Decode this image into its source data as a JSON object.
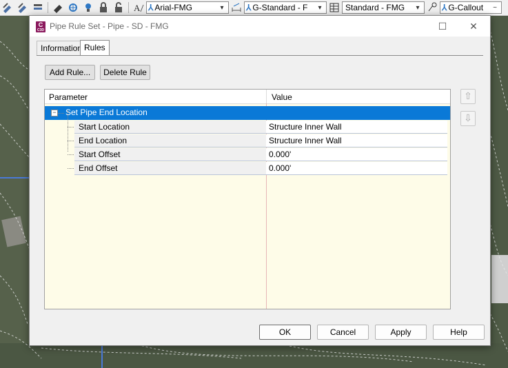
{
  "toolbar": {
    "text_style": "Arial-FMG",
    "dim_style": "G-Standard - F",
    "table_style": "Standard - FMG",
    "mleader_style": "G-Callout"
  },
  "dialog": {
    "app_icon_letter": "C",
    "app_icon_sub": "C3D",
    "title": "Pipe Rule Set - Pipe - SD  -  FMG",
    "maximize_glyph": "☐",
    "close_glyph": "✕",
    "tabs": [
      {
        "label": "Information",
        "active": false
      },
      {
        "label": "Rules",
        "active": true
      }
    ],
    "add_rule_label": "Add Rule...",
    "delete_rule_label": "Delete Rule",
    "grid": {
      "col_parameter": "Parameter",
      "col_value": "Value",
      "group": {
        "label": "Set Pipe End Location",
        "expander": "−"
      },
      "rows": [
        {
          "param": "Start Location",
          "value": "Structure Inner Wall"
        },
        {
          "param": "End Location",
          "value": "Structure Inner Wall"
        },
        {
          "param": "Start Offset",
          "value": "0.000'"
        },
        {
          "param": "End Offset",
          "value": "0.000'"
        }
      ]
    },
    "move_up_glyph": "⇧",
    "move_down_glyph": "⇩",
    "buttons": {
      "ok": "OK",
      "cancel": "Cancel",
      "apply": "Apply",
      "help": "Help"
    }
  }
}
